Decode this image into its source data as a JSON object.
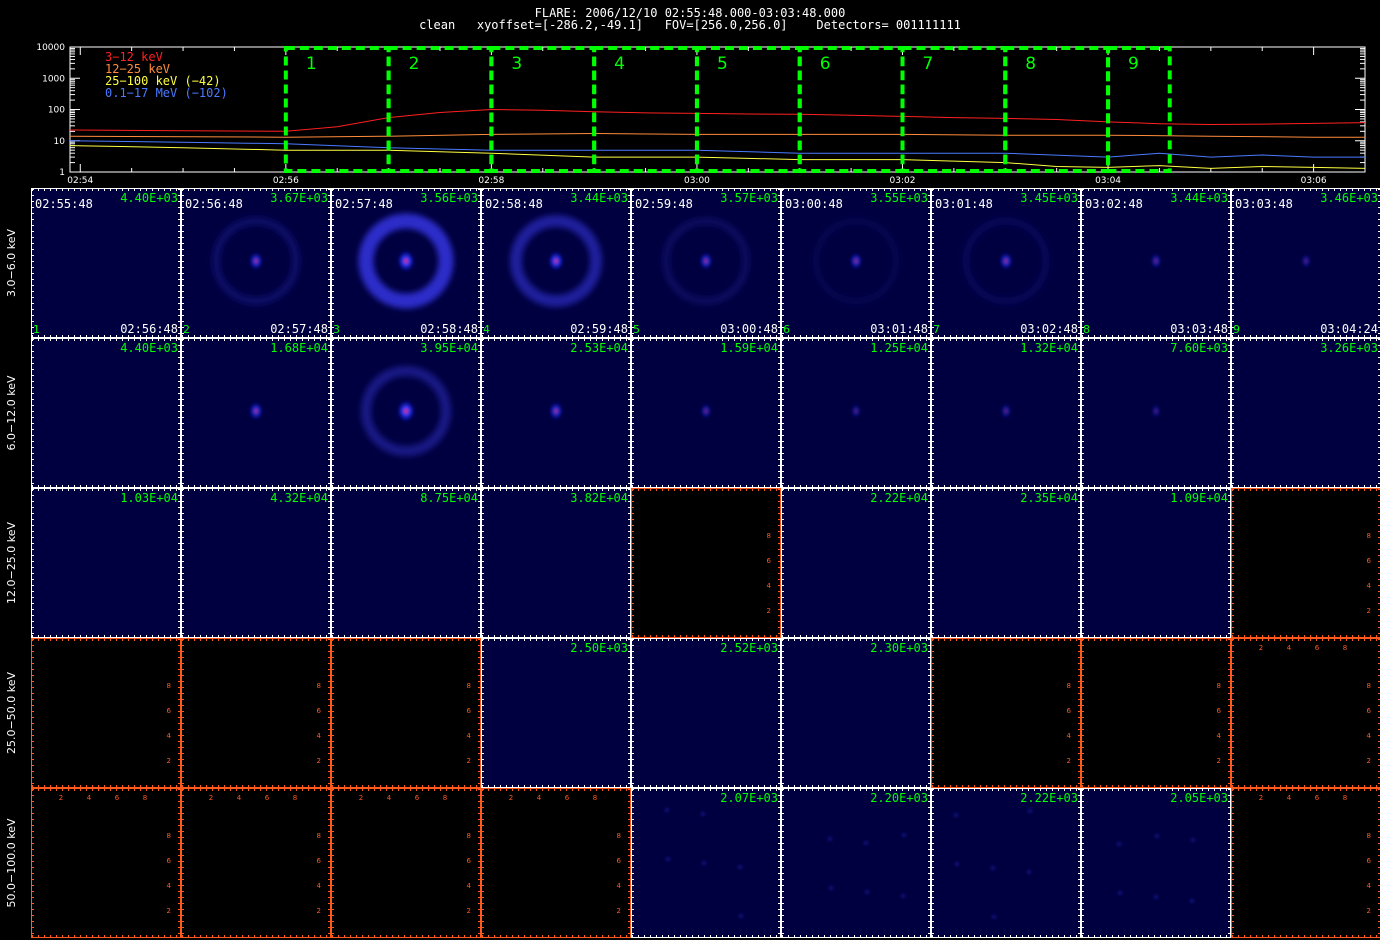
{
  "header": {
    "line1": "FLARE: 2006/12/10 02:55:48.000-03:03:48.000",
    "line2": "clean   xyoffset=[-286.2,-49.1]   FOV=[256.0,256.0]    Detectors= 001111111"
  },
  "colors": {
    "background": "#000000",
    "image_fill": "#000040",
    "grid": "#ffffff",
    "empty_axes": "#ff5a1e",
    "interval_box": "#00ff00",
    "counts_text": "#00ff00"
  },
  "chart_data": [
    {
      "type": "line",
      "title": "",
      "xlabel": "",
      "ylabel": "",
      "y_scale": "log",
      "ylim": [
        1,
        10000
      ],
      "y_ticks": [
        "10000",
        "1000",
        "100",
        "10",
        "1"
      ],
      "x_ticks": [
        "02:54",
        "02:56",
        "02:58",
        "03:00",
        "03:02",
        "03:04",
        "03:06"
      ],
      "x_range_minutes": [
        -0.1,
        12.5
      ],
      "legend_position": "top-left",
      "series": [
        {
          "name": "3−12 keV",
          "color": "#ff2020",
          "x": [
            -0.1,
            1.0,
            2.0,
            2.5,
            3.0,
            3.5,
            4.0,
            4.5,
            5.0,
            5.5,
            6.0,
            6.5,
            7.0,
            7.5,
            8.0,
            8.5,
            9.0,
            9.5,
            10.0,
            10.5,
            11.0,
            11.5,
            12.0,
            12.5
          ],
          "values": [
            22,
            21,
            20,
            28,
            55,
            80,
            100,
            95,
            85,
            78,
            75,
            72,
            70,
            65,
            60,
            55,
            52,
            48,
            40,
            35,
            33,
            34,
            36,
            38
          ]
        },
        {
          "name": "12−25 keV",
          "color": "#ff8c3c",
          "x": [
            -0.1,
            2.0,
            3.0,
            4.0,
            5.0,
            6.0,
            7.0,
            8.0,
            9.0,
            10.0,
            11.0,
            12.0,
            12.5
          ],
          "values": [
            14,
            13,
            14,
            16,
            17,
            16,
            16,
            16,
            15,
            15,
            14,
            13,
            13
          ]
        },
        {
          "name": "25−100 keV (−42)",
          "color": "#ffff40",
          "x": [
            -0.1,
            1.0,
            2.0,
            3.0,
            4.0,
            5.0,
            6.0,
            7.0,
            8.0,
            9.0,
            9.5,
            10.0,
            10.5,
            11.0,
            11.5,
            12.0,
            12.5
          ],
          "values": [
            7,
            6,
            5,
            5,
            4,
            3,
            3,
            2.5,
            2.5,
            2,
            1.5,
            1.4,
            1.6,
            1.3,
            1.5,
            1.4,
            1.3
          ]
        },
        {
          "name": "0.1−17 MeV (−102)",
          "color": "#4a7aff",
          "x": [
            -0.1,
            1.0,
            2.0,
            3.0,
            4.0,
            5.0,
            6.0,
            7.0,
            8.0,
            9.0,
            10.0,
            10.5,
            11.0,
            11.5,
            12.0,
            12.5
          ],
          "values": [
            10,
            9,
            8,
            6,
            5,
            5,
            5,
            4,
            4,
            4,
            3,
            4,
            3,
            3.5,
            3,
            3
          ]
        }
      ],
      "intervals": [
        {
          "label": "1",
          "start": 2.0,
          "end": 3.0
        },
        {
          "label": "2",
          "start": 3.0,
          "end": 4.0
        },
        {
          "label": "3",
          "start": 4.0,
          "end": 5.0
        },
        {
          "label": "4",
          "start": 5.0,
          "end": 6.0
        },
        {
          "label": "5",
          "start": 6.0,
          "end": 7.0
        },
        {
          "label": "6",
          "start": 7.0,
          "end": 8.0
        },
        {
          "label": "7",
          "start": 8.0,
          "end": 9.0
        },
        {
          "label": "8",
          "start": 9.0,
          "end": 10.0
        },
        {
          "label": "9",
          "start": 10.0,
          "end": 10.6
        }
      ]
    },
    {
      "type": "heatmap",
      "title": "",
      "row_labels": [
        "3.0−6.0 keV",
        "6.0−12.0 keV",
        "12.0−25.0 keV",
        "25.0−50.0 keV",
        "50.0−100.0 keV"
      ],
      "col_start_times": [
        "02:55:48",
        "02:56:48",
        "02:57:48",
        "02:58:48",
        "02:59:48",
        "03:00:48",
        "03:01:48",
        "03:02:48",
        "03:03:48"
      ],
      "col_end_times": [
        "02:56:48",
        "02:57:48",
        "02:58:48",
        "02:59:48",
        "03:00:48",
        "03:01:48",
        "03:02:48",
        "03:03:48",
        "03:04:24"
      ],
      "col_numbers": [
        "1",
        "2",
        "3",
        "4",
        "5",
        "6",
        "7",
        "8",
        "9"
      ],
      "empty_axis_ticks": [
        "2",
        "4",
        "6",
        "8"
      ],
      "max_counts": [
        [
          "4.40E+03",
          "3.67E+03",
          "3.56E+03",
          "3.44E+03",
          "3.57E+03",
          "3.55E+03",
          "3.45E+03",
          "3.44E+03",
          "3.46E+03"
        ],
        [
          "4.40E+03",
          "1.68E+04",
          "3.95E+04",
          "2.53E+04",
          "1.59E+04",
          "1.25E+04",
          "1.32E+04",
          "7.60E+03",
          "3.26E+03"
        ],
        [
          "1.03E+04",
          "4.32E+04",
          "8.75E+04",
          "3.82E+04",
          "",
          "2.22E+04",
          "2.35E+04",
          "1.09E+04",
          ""
        ],
        [
          "",
          "",
          "",
          "2.50E+03",
          "2.52E+03",
          "2.30E+03",
          "",
          "",
          ""
        ],
        [
          "",
          "",
          "",
          "",
          "2.07E+03",
          "2.20E+03",
          "2.22E+03",
          "2.05E+03",
          ""
        ]
      ],
      "has_image": [
        [
          true,
          true,
          true,
          true,
          true,
          true,
          true,
          true,
          true
        ],
        [
          true,
          true,
          true,
          true,
          true,
          true,
          true,
          true,
          true
        ],
        [
          true,
          true,
          true,
          true,
          false,
          true,
          true,
          true,
          false
        ],
        [
          false,
          false,
          false,
          true,
          true,
          true,
          false,
          false,
          false
        ],
        [
          false,
          false,
          false,
          false,
          true,
          true,
          true,
          true,
          false
        ]
      ],
      "empty_frame": [
        [
          false,
          false,
          false,
          false,
          false,
          false,
          false,
          false,
          false
        ],
        [
          false,
          false,
          false,
          false,
          false,
          false,
          false,
          false,
          false
        ],
        [
          false,
          false,
          false,
          false,
          true,
          false,
          false,
          false,
          true
        ],
        [
          true,
          true,
          true,
          false,
          false,
          false,
          true,
          true,
          true
        ],
        [
          true,
          true,
          true,
          true,
          false,
          false,
          false,
          false,
          true
        ]
      ],
      "source_intensity": [
        [
          0,
          0.6,
          0.9,
          0.75,
          0.55,
          0.5,
          0.55,
          0.35,
          0.25
        ],
        [
          0,
          0.6,
          0.95,
          0.6,
          0.35,
          0.25,
          0.3,
          0.2,
          0
        ],
        [
          0,
          0,
          0,
          0,
          0,
          0,
          0,
          0,
          0
        ],
        [
          0,
          0,
          0,
          0,
          0,
          0,
          0,
          0,
          0
        ],
        [
          0,
          0,
          0,
          0,
          0,
          0,
          0,
          0,
          0
        ]
      ],
      "ring_intensity": [
        [
          0,
          0.25,
          0.9,
          0.6,
          0.2,
          0.1,
          0.15,
          0,
          0
        ],
        [
          0,
          0,
          0.45,
          0,
          0,
          0,
          0,
          0,
          0
        ],
        [
          0,
          0,
          0,
          0,
          0,
          0,
          0,
          0,
          0
        ],
        [
          0,
          0,
          0,
          0,
          0,
          0,
          0,
          0,
          0
        ],
        [
          0,
          0,
          0,
          0,
          0,
          0,
          0,
          0,
          0
        ]
      ]
    }
  ]
}
